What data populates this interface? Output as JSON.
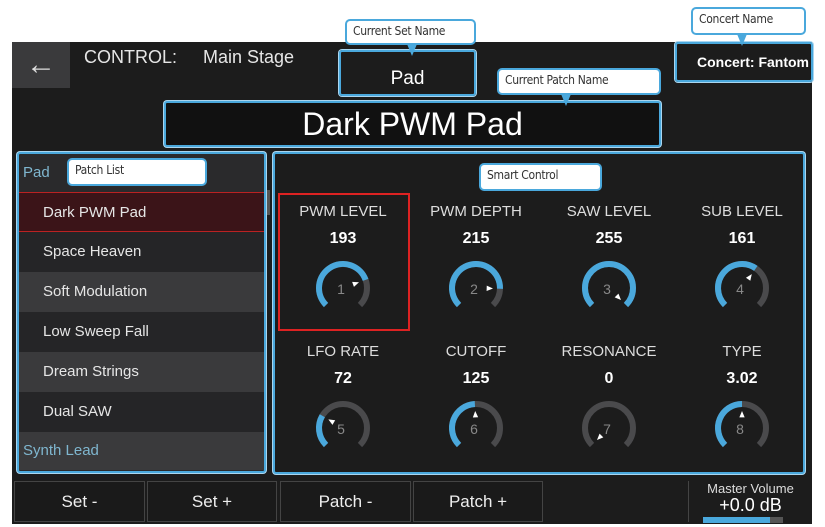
{
  "header": {
    "control_label": "CONTROL:",
    "scene": "Main Stage",
    "set_name": "Pad",
    "patch_name": "Dark PWM Pad",
    "concert": "Concert: Fantom"
  },
  "callouts": {
    "set": "Current Set Name",
    "concert": "Concert Name",
    "patch": "Current Patch Name",
    "list": "Patch List",
    "smart": "Smart Control"
  },
  "patch_list": {
    "group": "Pad",
    "items": [
      "Dark PWM Pad",
      "Space Heaven",
      "Soft Modulation",
      "Low Sweep Fall",
      "Dream Strings",
      "Dual SAW"
    ],
    "next_group": "Synth Lead",
    "selected_index": 0
  },
  "controls": [
    {
      "label": "PWM LEVEL",
      "value": "193",
      "num": "1",
      "fraction": 0.76
    },
    {
      "label": "PWM DEPTH",
      "value": "215",
      "num": "2",
      "fraction": 0.84
    },
    {
      "label": "SAW LEVEL",
      "value": "255",
      "num": "3",
      "fraction": 1.0
    },
    {
      "label": "SUB LEVEL",
      "value": "161",
      "num": "4",
      "fraction": 0.63
    },
    {
      "label": "LFO RATE",
      "value": "72",
      "num": "5",
      "fraction": 0.28
    },
    {
      "label": "CUTOFF",
      "value": "125",
      "num": "6",
      "fraction": 0.49
    },
    {
      "label": "RESONANCE",
      "value": "0",
      "num": "7",
      "fraction": 0.0
    },
    {
      "label": "TYPE",
      "value": "3.02",
      "num": "8",
      "fraction": 0.5
    }
  ],
  "buttons": {
    "set_minus": "Set -",
    "set_plus": "Set +",
    "patch_minus": "Patch -",
    "patch_plus": "Patch +"
  },
  "master": {
    "label": "Master Volume",
    "value": "+0.0 dB",
    "level": 0.84
  },
  "colors": {
    "accent": "#4aa8dc",
    "selected": "#dd2222"
  }
}
